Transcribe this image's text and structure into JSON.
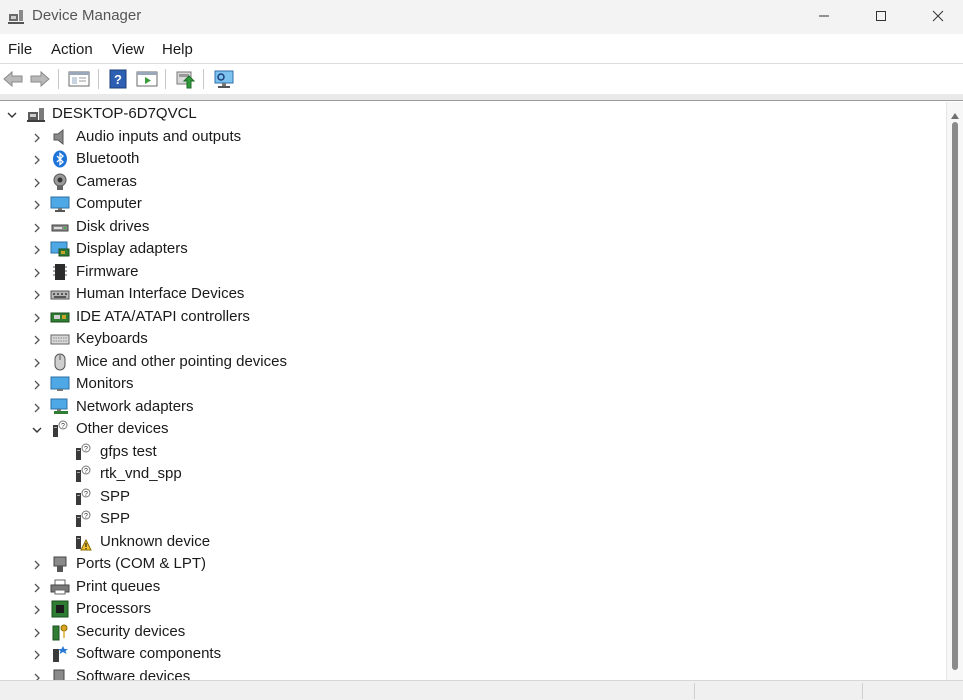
{
  "window": {
    "title": "Device Manager",
    "icon": "device-manager-icon"
  },
  "menu": [
    "File",
    "Action",
    "View",
    "Help"
  ],
  "toolbar": [
    "back-arrow-icon",
    "forward-arrow-icon",
    "properties-icon",
    "help-icon",
    "run-icon",
    "update-driver-icon",
    "scan-hardware-icon"
  ],
  "tree": {
    "root": "DESKTOP-6D7QVCL",
    "categories": [
      {
        "label": "Audio inputs and outputs",
        "icon": "speaker-icon"
      },
      {
        "label": "Bluetooth",
        "icon": "bluetooth-icon"
      },
      {
        "label": "Cameras",
        "icon": "camera-icon"
      },
      {
        "label": "Computer",
        "icon": "computer-icon"
      },
      {
        "label": "Disk drives",
        "icon": "disk-drive-icon"
      },
      {
        "label": "Display adapters",
        "icon": "display-adapter-icon"
      },
      {
        "label": "Firmware",
        "icon": "firmware-icon"
      },
      {
        "label": "Human Interface Devices",
        "icon": "hid-icon"
      },
      {
        "label": "IDE ATA/ATAPI controllers",
        "icon": "ide-controller-icon"
      },
      {
        "label": "Keyboards",
        "icon": "keyboard-icon"
      },
      {
        "label": "Mice and other pointing devices",
        "icon": "mouse-icon"
      },
      {
        "label": "Monitors",
        "icon": "monitor-icon"
      },
      {
        "label": "Network adapters",
        "icon": "network-adapter-icon"
      },
      {
        "label": "Other devices",
        "icon": "unknown-device-icon",
        "expanded": true
      },
      {
        "label": "Ports (COM & LPT)",
        "icon": "port-icon"
      },
      {
        "label": "Print queues",
        "icon": "printer-icon"
      },
      {
        "label": "Processors",
        "icon": "processor-icon"
      },
      {
        "label": "Security devices",
        "icon": "security-device-icon"
      },
      {
        "label": "Software components",
        "icon": "software-component-icon"
      },
      {
        "label": "Software devices",
        "icon": "software-device-icon"
      }
    ],
    "other_devices": [
      {
        "label": "gfps test",
        "icon": "unknown-device-icon"
      },
      {
        "label": "rtk_vnd_spp",
        "icon": "unknown-device-icon"
      },
      {
        "label": "SPP",
        "icon": "unknown-device-icon"
      },
      {
        "label": "SPP",
        "icon": "unknown-device-icon"
      },
      {
        "label": "Unknown device",
        "icon": "warning-device-icon"
      }
    ]
  }
}
